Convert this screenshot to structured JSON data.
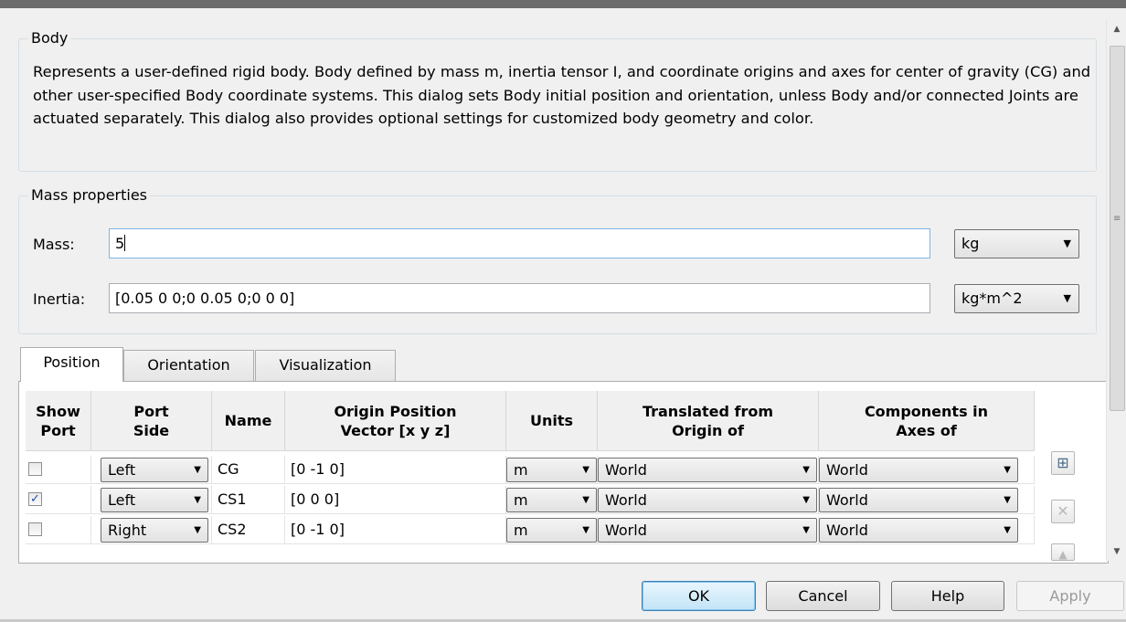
{
  "body_group": {
    "title": "Body",
    "description": "Represents a user-defined rigid body. Body defined by mass m, inertia tensor I, and coordinate origins and axes for center of gravity (CG) and other user-specified Body coordinate systems. This dialog sets Body initial position and orientation, unless Body and/or connected Joints are actuated separately. This dialog also provides optional settings for customized body geometry and color."
  },
  "mass_group": {
    "title": "Mass properties",
    "mass_label": "Mass:",
    "mass_value": "5",
    "mass_unit": "kg",
    "inertia_label": "Inertia:",
    "inertia_value": "[0.05 0 0;0 0.05 0;0 0 0]",
    "inertia_unit": "kg*m^2"
  },
  "tabs": [
    {
      "label": "Position",
      "active": true
    },
    {
      "label": "Orientation",
      "active": false
    },
    {
      "label": "Visualization",
      "active": false
    }
  ],
  "table": {
    "headers": [
      "Show\nPort",
      "Port\nSide",
      "Name",
      "Origin Position\nVector [x y z]",
      "Units",
      "Translated from\nOrigin of",
      "Components in\nAxes of"
    ],
    "rows": [
      {
        "show_port": false,
        "port_side": "Left",
        "name": "CG",
        "origin": "[0 -1 0]",
        "units": "m",
        "translated": "World",
        "components": "World"
      },
      {
        "show_port": true,
        "port_side": "Left",
        "name": "CS1",
        "origin": "[0 0 0]",
        "units": "m",
        "translated": "World",
        "components": "World"
      },
      {
        "show_port": false,
        "port_side": "Right",
        "name": "CS2",
        "origin": "[0 -1 0]",
        "units": "m",
        "translated": "World",
        "components": "World"
      }
    ]
  },
  "buttons": {
    "ok": "OK",
    "cancel": "Cancel",
    "help": "Help",
    "apply": "Apply"
  },
  "icons": {
    "check": "✓",
    "dropdown": "▼",
    "scroll_up": "▲",
    "scroll_down": "▼",
    "grip": "≡",
    "add": "⊞",
    "delete": "✕",
    "move_up": "▲"
  }
}
